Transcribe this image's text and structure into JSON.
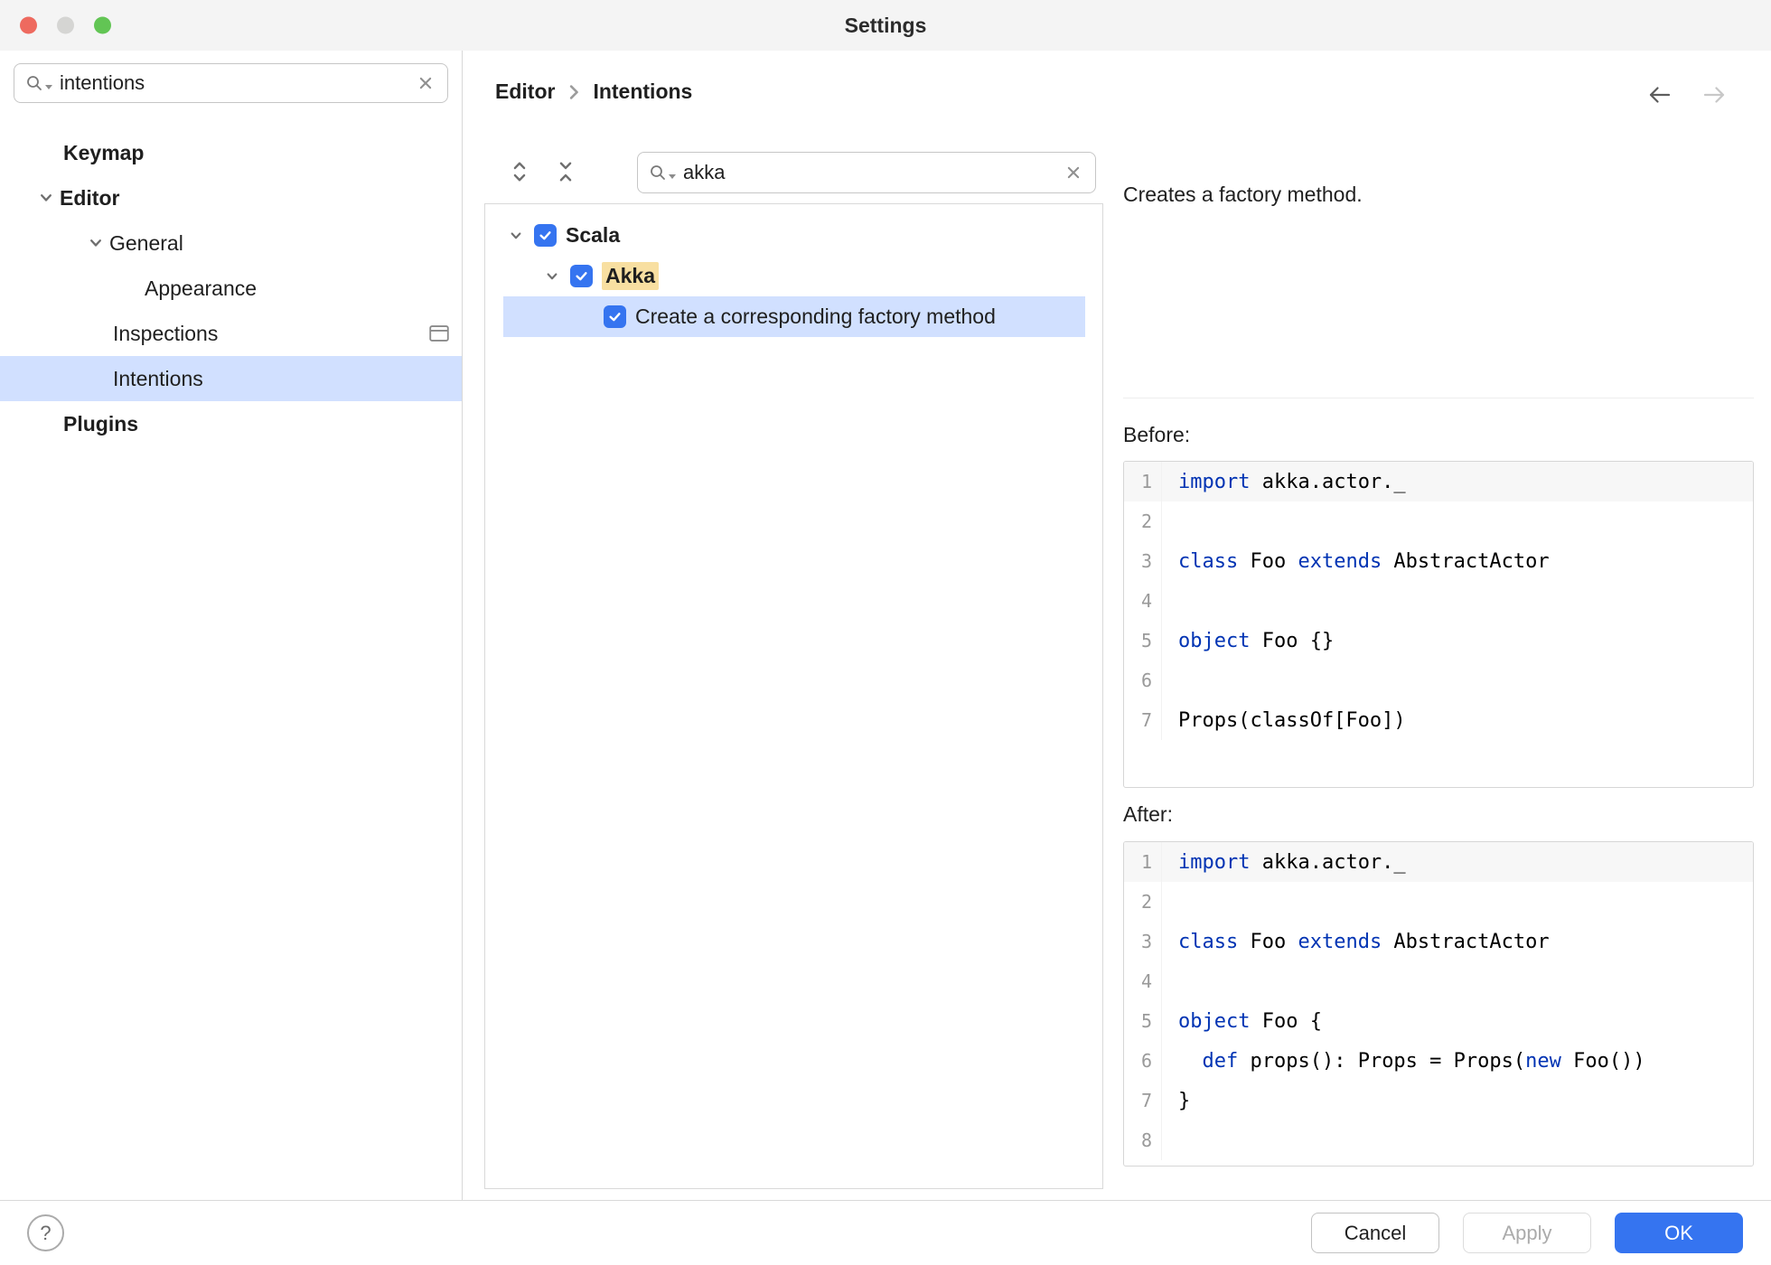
{
  "window": {
    "title": "Settings"
  },
  "sidebar": {
    "search": {
      "value": "intentions"
    },
    "items": {
      "keymap": {
        "label": "Keymap"
      },
      "editor": {
        "label": "Editor"
      },
      "general": {
        "label": "General"
      },
      "appearance": {
        "label": "Appearance"
      },
      "inspections": {
        "label": "Inspections"
      },
      "intentions": {
        "label": "Intentions"
      },
      "plugins": {
        "label": "Plugins"
      }
    }
  },
  "breadcrumb": {
    "parent": "Editor",
    "current": "Intentions"
  },
  "main": {
    "search": {
      "value": "akka"
    },
    "tree": {
      "scala": {
        "label": "Scala",
        "checked": true
      },
      "akka": {
        "label": "Akka",
        "checked": true
      },
      "factory": {
        "label": "Create a corresponding factory method",
        "checked": true
      }
    },
    "description": "Creates a factory method.",
    "before": {
      "label": "Before:",
      "code": [
        [
          {
            "c": "k",
            "t": "import"
          },
          {
            "c": "p",
            "t": " akka.actor._"
          }
        ],
        [],
        [
          {
            "c": "k",
            "t": "class"
          },
          {
            "c": "p",
            "t": " Foo "
          },
          {
            "c": "k",
            "t": "extends"
          },
          {
            "c": "p",
            "t": " AbstractActor"
          }
        ],
        [],
        [
          {
            "c": "k",
            "t": "object"
          },
          {
            "c": "p",
            "t": " Foo {}"
          }
        ],
        [],
        [
          {
            "c": "p",
            "t": "Props(classOf[Foo])"
          }
        ]
      ]
    },
    "after": {
      "label": "After:",
      "code": [
        [
          {
            "c": "k",
            "t": "import"
          },
          {
            "c": "p",
            "t": " akka.actor._"
          }
        ],
        [],
        [
          {
            "c": "k",
            "t": "class"
          },
          {
            "c": "p",
            "t": " Foo "
          },
          {
            "c": "k",
            "t": "extends"
          },
          {
            "c": "p",
            "t": " AbstractActor"
          }
        ],
        [],
        [
          {
            "c": "k",
            "t": "object"
          },
          {
            "c": "p",
            "t": " Foo {"
          }
        ],
        [
          {
            "c": "p",
            "t": "  "
          },
          {
            "c": "k",
            "t": "def"
          },
          {
            "c": "p",
            "t": " props(): Props = Props("
          },
          {
            "c": "k",
            "t": "new"
          },
          {
            "c": "p",
            "t": " Foo())"
          }
        ],
        [
          {
            "c": "p",
            "t": "}"
          }
        ],
        []
      ]
    }
  },
  "footer": {
    "help": "?",
    "cancel": "Cancel",
    "apply": "Apply",
    "ok": "OK"
  },
  "colors": {
    "accent": "#3574F0",
    "selection": "#D1E0FF",
    "match_highlight": "#F8DFA1",
    "keyword": "#0033B3"
  }
}
